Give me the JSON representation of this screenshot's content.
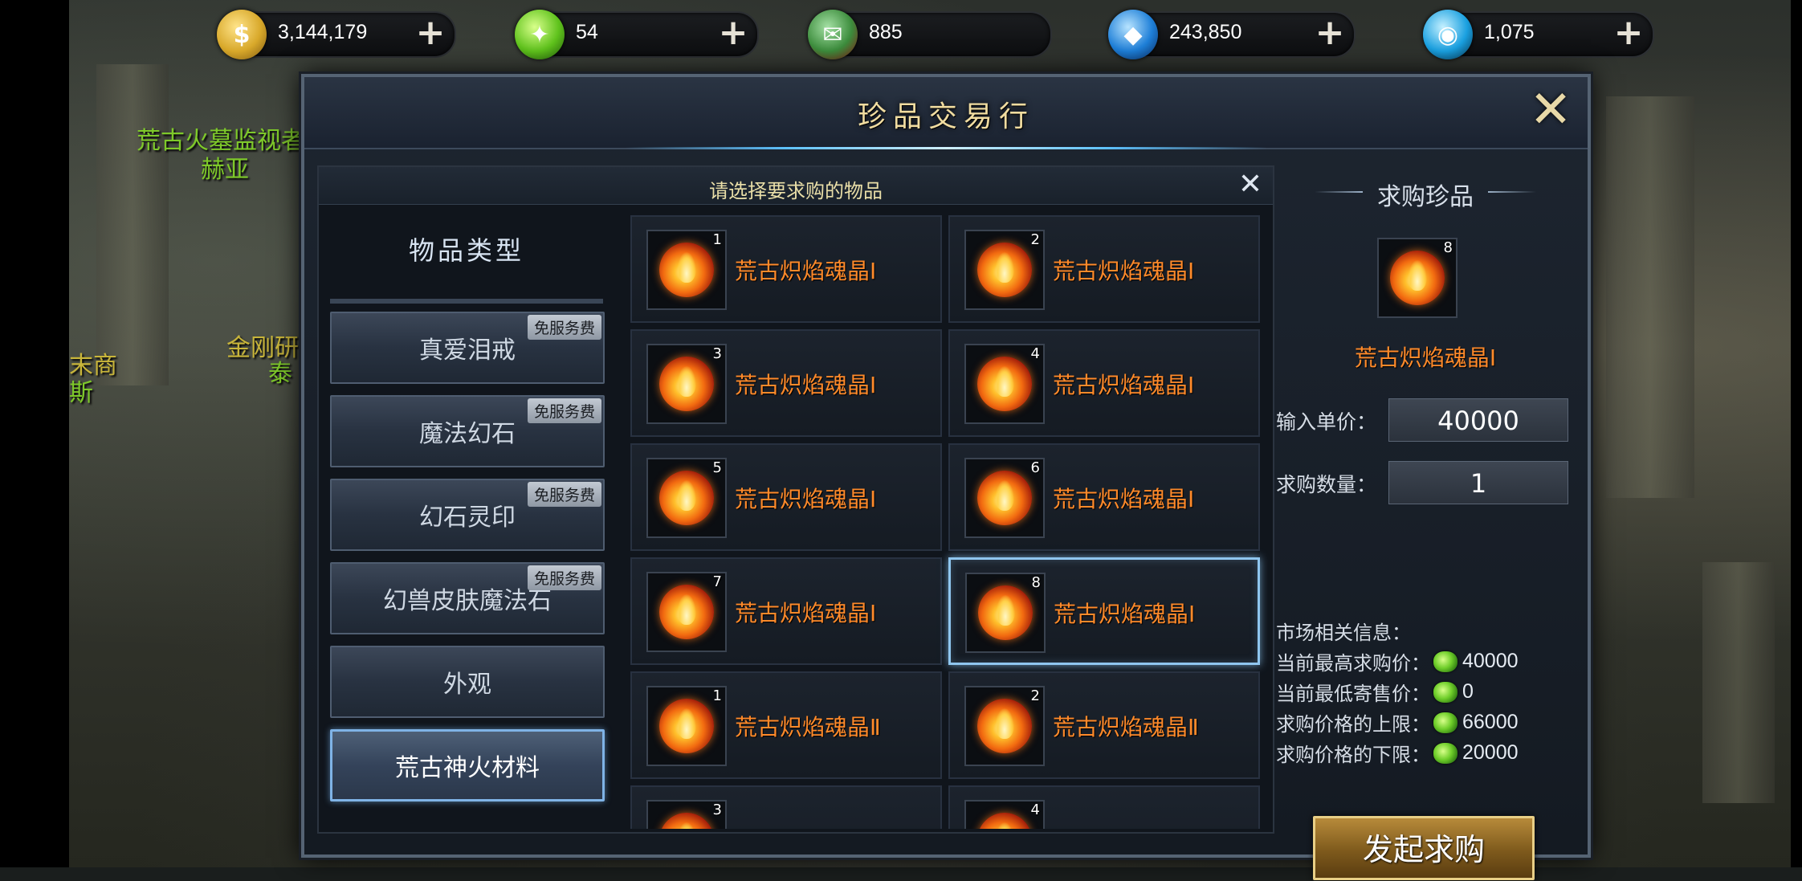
{
  "currencies": [
    {
      "icon": "gold-coin-icon",
      "symbol": "$",
      "value": "3,144,179",
      "color": "#d8a82a"
    },
    {
      "icon": "green-gem-icon",
      "symbol": "✦",
      "value": "54",
      "color": "#5fc21c"
    },
    {
      "icon": "red-ticket-icon",
      "symbol": "✉",
      "value": "885",
      "color": "#3c8c3c"
    },
    {
      "icon": "blue-crystal-icon",
      "symbol": "◆",
      "value": "243,850",
      "color": "#1e7fd8"
    },
    {
      "icon": "blue-swirl-icon",
      "symbol": "◉",
      "value": "1,075",
      "color": "#1aa0e0"
    }
  ],
  "plus_label": "+",
  "npc_names": [
    "荒古火墓监视者",
    "赫亚",
    "金刚研",
    "末商",
    "斯",
    "泰"
  ],
  "dialog": {
    "title": "珍品交易行",
    "close_label": "✕"
  },
  "sub_panel": {
    "header": "请选择要求购的物品",
    "close_label": "✕"
  },
  "categories": {
    "header": "物品类型",
    "tag": "免服务费",
    "items": [
      {
        "label": "真爱泪戒",
        "tag": true
      },
      {
        "label": "魔法幻石",
        "tag": true
      },
      {
        "label": "幻石灵印",
        "tag": true
      },
      {
        "label": "幻兽皮肤魔法石",
        "tag": true
      },
      {
        "label": "外观",
        "tag": false
      },
      {
        "label": "荒古神火材料",
        "tag": false,
        "active": true
      }
    ]
  },
  "items": [
    {
      "name": "荒古炽焰魂晶Ⅰ",
      "grade": "1"
    },
    {
      "name": "荒古炽焰魂晶Ⅰ",
      "grade": "2"
    },
    {
      "name": "荒古炽焰魂晶Ⅰ",
      "grade": "3"
    },
    {
      "name": "荒古炽焰魂晶Ⅰ",
      "grade": "4"
    },
    {
      "name": "荒古炽焰魂晶Ⅰ",
      "grade": "5"
    },
    {
      "name": "荒古炽焰魂晶Ⅰ",
      "grade": "6"
    },
    {
      "name": "荒古炽焰魂晶Ⅰ",
      "grade": "7"
    },
    {
      "name": "荒古炽焰魂晶Ⅰ",
      "grade": "8",
      "selected": true
    },
    {
      "name": "荒古炽焰魂晶Ⅱ",
      "grade": "1"
    },
    {
      "name": "荒古炽焰魂晶Ⅱ",
      "grade": "2"
    },
    {
      "name": "",
      "grade": "3"
    },
    {
      "name": "",
      "grade": "4"
    }
  ],
  "purchase": {
    "title": "求购珍品",
    "selected_item": {
      "name": "荒古炽焰魂晶Ⅰ",
      "grade": "8"
    },
    "price_label": "输入单价：",
    "price_value": "40000",
    "qty_label": "求购数量：",
    "qty_value": "1",
    "market_title": "市场相关信息：",
    "market_rows": [
      {
        "label": "当前最高求购价：",
        "value": "40000"
      },
      {
        "label": "当前最低寄售价：",
        "value": "0"
      },
      {
        "label": "求购价格的上限：",
        "value": "66000"
      },
      {
        "label": "求购价格的下限：",
        "value": "20000"
      }
    ],
    "submit_label": "发起求购"
  }
}
